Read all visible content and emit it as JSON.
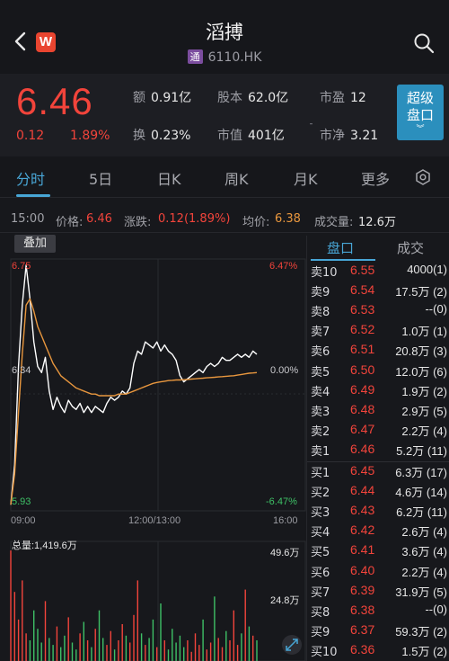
{
  "header": {
    "title": "滔搏",
    "tag": "通",
    "code": "6110.HK",
    "logo_letter": "W"
  },
  "quote": {
    "price": "6.46",
    "change": "0.12",
    "change_pct": "1.89%",
    "stats": [
      {
        "label": "额",
        "value": "0.91亿"
      },
      {
        "label": "股本",
        "value": "62.0亿"
      },
      {
        "label": "市盈",
        "value": "12"
      },
      {
        "label": "换",
        "value": "0.23%"
      },
      {
        "label": "市值",
        "value": "401亿"
      },
      {
        "label": "市净",
        "value": "3.21"
      }
    ],
    "super_button": [
      "超级",
      "盘口"
    ]
  },
  "tabs": [
    "分时",
    "5日",
    "日K",
    "周K",
    "月K",
    "更多"
  ],
  "info_bar": {
    "time": "15:00",
    "price_label": "价格:",
    "price": "6.46",
    "change_label": "涨跌:",
    "change": "0.12(1.89%)",
    "avg_label": "均价:",
    "avg": "6.38",
    "volume_label": "成交量:",
    "volume": "12.6万"
  },
  "chart": {
    "overlay_label": "叠加",
    "y_left": {
      "top": "6.75",
      "mid": "6.34",
      "bottom": "5.93"
    },
    "y_right": {
      "top": "6.47%",
      "mid": "0.00%",
      "bottom": "-6.47%"
    },
    "x_labels": [
      "09:00",
      "12:00/13:00",
      "16:00"
    ],
    "volume_total_label": "总量:1,419.6万",
    "volume_ticks": [
      "49.6万",
      "24.8万"
    ],
    "colors": {
      "price_line": "#ffffff",
      "avg_line": "#e9973e",
      "up": "#f2443b",
      "down": "#3ec066"
    }
  },
  "chart_data": {
    "type": "line",
    "title": "",
    "xlabel": "",
    "ylabel": "",
    "x_range": [
      "09:00",
      "16:00"
    ],
    "ylim": [
      5.93,
      6.75
    ],
    "series": [
      {
        "name": "价格",
        "values": [
          5.95,
          6.08,
          6.4,
          6.6,
          6.73,
          6.62,
          6.48,
          6.4,
          6.38,
          6.43,
          6.32,
          6.26,
          6.3,
          6.27,
          6.25,
          6.29,
          6.27,
          6.26,
          6.28,
          6.25,
          6.27,
          6.25,
          6.27,
          6.26,
          6.25,
          6.28,
          6.3,
          6.29,
          6.3,
          6.32,
          6.31,
          6.33,
          6.41,
          6.45,
          6.44,
          6.48,
          6.47,
          6.46,
          6.48,
          6.45,
          6.47,
          6.45,
          6.44,
          6.42,
          6.37,
          6.35,
          6.36,
          6.37,
          6.38,
          6.39,
          6.38,
          6.4,
          6.41,
          6.4,
          6.41,
          6.43,
          6.42,
          6.42,
          6.43,
          6.44,
          6.43,
          6.44,
          6.43,
          6.45,
          6.44
        ]
      },
      {
        "name": "均价",
        "values": [
          5.95,
          6.05,
          6.25,
          6.44,
          6.6,
          6.62,
          6.58,
          6.53,
          6.5,
          6.47,
          6.44,
          6.41,
          6.39,
          6.37,
          6.36,
          6.35,
          6.34,
          6.33,
          6.325,
          6.32,
          6.315,
          6.31,
          6.31,
          6.305,
          6.305,
          6.305,
          6.305,
          6.305,
          6.31,
          6.31,
          6.31,
          6.315,
          6.32,
          6.325,
          6.33,
          6.335,
          6.34,
          6.345,
          6.348,
          6.35,
          6.352,
          6.354,
          6.355,
          6.356,
          6.356,
          6.357,
          6.358,
          6.359,
          6.36,
          6.361,
          6.362,
          6.363,
          6.364,
          6.365,
          6.366,
          6.367,
          6.368,
          6.369,
          6.37,
          6.372,
          6.374,
          6.376,
          6.378,
          6.379,
          6.38
        ]
      }
    ],
    "volume_ylim": [
      0,
      49.6
    ],
    "volume_unit": "万",
    "volume": [
      48,
      30,
      18,
      35,
      12,
      9,
      22,
      14,
      8,
      26,
      10,
      7,
      15,
      6,
      11,
      19,
      8,
      5,
      12,
      17,
      9,
      6,
      14,
      22,
      10,
      7,
      13,
      5,
      9,
      16,
      11,
      8,
      20,
      35,
      12,
      7,
      10,
      18,
      6,
      25,
      9,
      5,
      14,
      8,
      11,
      6,
      9,
      4,
      12,
      7,
      18,
      5,
      8,
      28,
      10,
      6,
      13,
      9,
      22,
      7,
      12,
      31,
      15,
      11,
      9
    ]
  },
  "order_book": {
    "tabs": [
      "盘口",
      "成交"
    ],
    "asks": [
      {
        "level": "卖10",
        "price": "6.55",
        "volume": "4000(1)"
      },
      {
        "level": "卖9",
        "price": "6.54",
        "volume": "17.5万 (2)"
      },
      {
        "level": "卖8",
        "price": "6.53",
        "volume": "--(0)"
      },
      {
        "level": "卖7",
        "price": "6.52",
        "volume": "1.0万 (1)"
      },
      {
        "level": "卖6",
        "price": "6.51",
        "volume": "20.8万 (3)"
      },
      {
        "level": "卖5",
        "price": "6.50",
        "volume": "12.0万 (6)"
      },
      {
        "level": "卖4",
        "price": "6.49",
        "volume": "1.9万 (2)"
      },
      {
        "level": "卖3",
        "price": "6.48",
        "volume": "2.9万 (5)"
      },
      {
        "level": "卖2",
        "price": "6.47",
        "volume": "2.2万 (4)"
      },
      {
        "level": "卖1",
        "price": "6.46",
        "volume": "5.2万 (11)"
      }
    ],
    "bids": [
      {
        "level": "买1",
        "price": "6.45",
        "volume": "6.3万 (17)"
      },
      {
        "level": "买2",
        "price": "6.44",
        "volume": "4.6万 (14)"
      },
      {
        "level": "买3",
        "price": "6.43",
        "volume": "6.2万 (11)"
      },
      {
        "level": "买4",
        "price": "6.42",
        "volume": "2.6万 (4)"
      },
      {
        "level": "买5",
        "price": "6.41",
        "volume": "3.6万 (4)"
      },
      {
        "level": "买6",
        "price": "6.40",
        "volume": "2.2万 (4)"
      },
      {
        "level": "买7",
        "price": "6.39",
        "volume": "31.9万 (5)"
      },
      {
        "level": "买8",
        "price": "6.38",
        "volume": "--(0)"
      },
      {
        "level": "买9",
        "price": "6.37",
        "volume": "59.3万 (2)"
      },
      {
        "level": "买10",
        "price": "6.36",
        "volume": "1.5万 (2)"
      }
    ]
  }
}
